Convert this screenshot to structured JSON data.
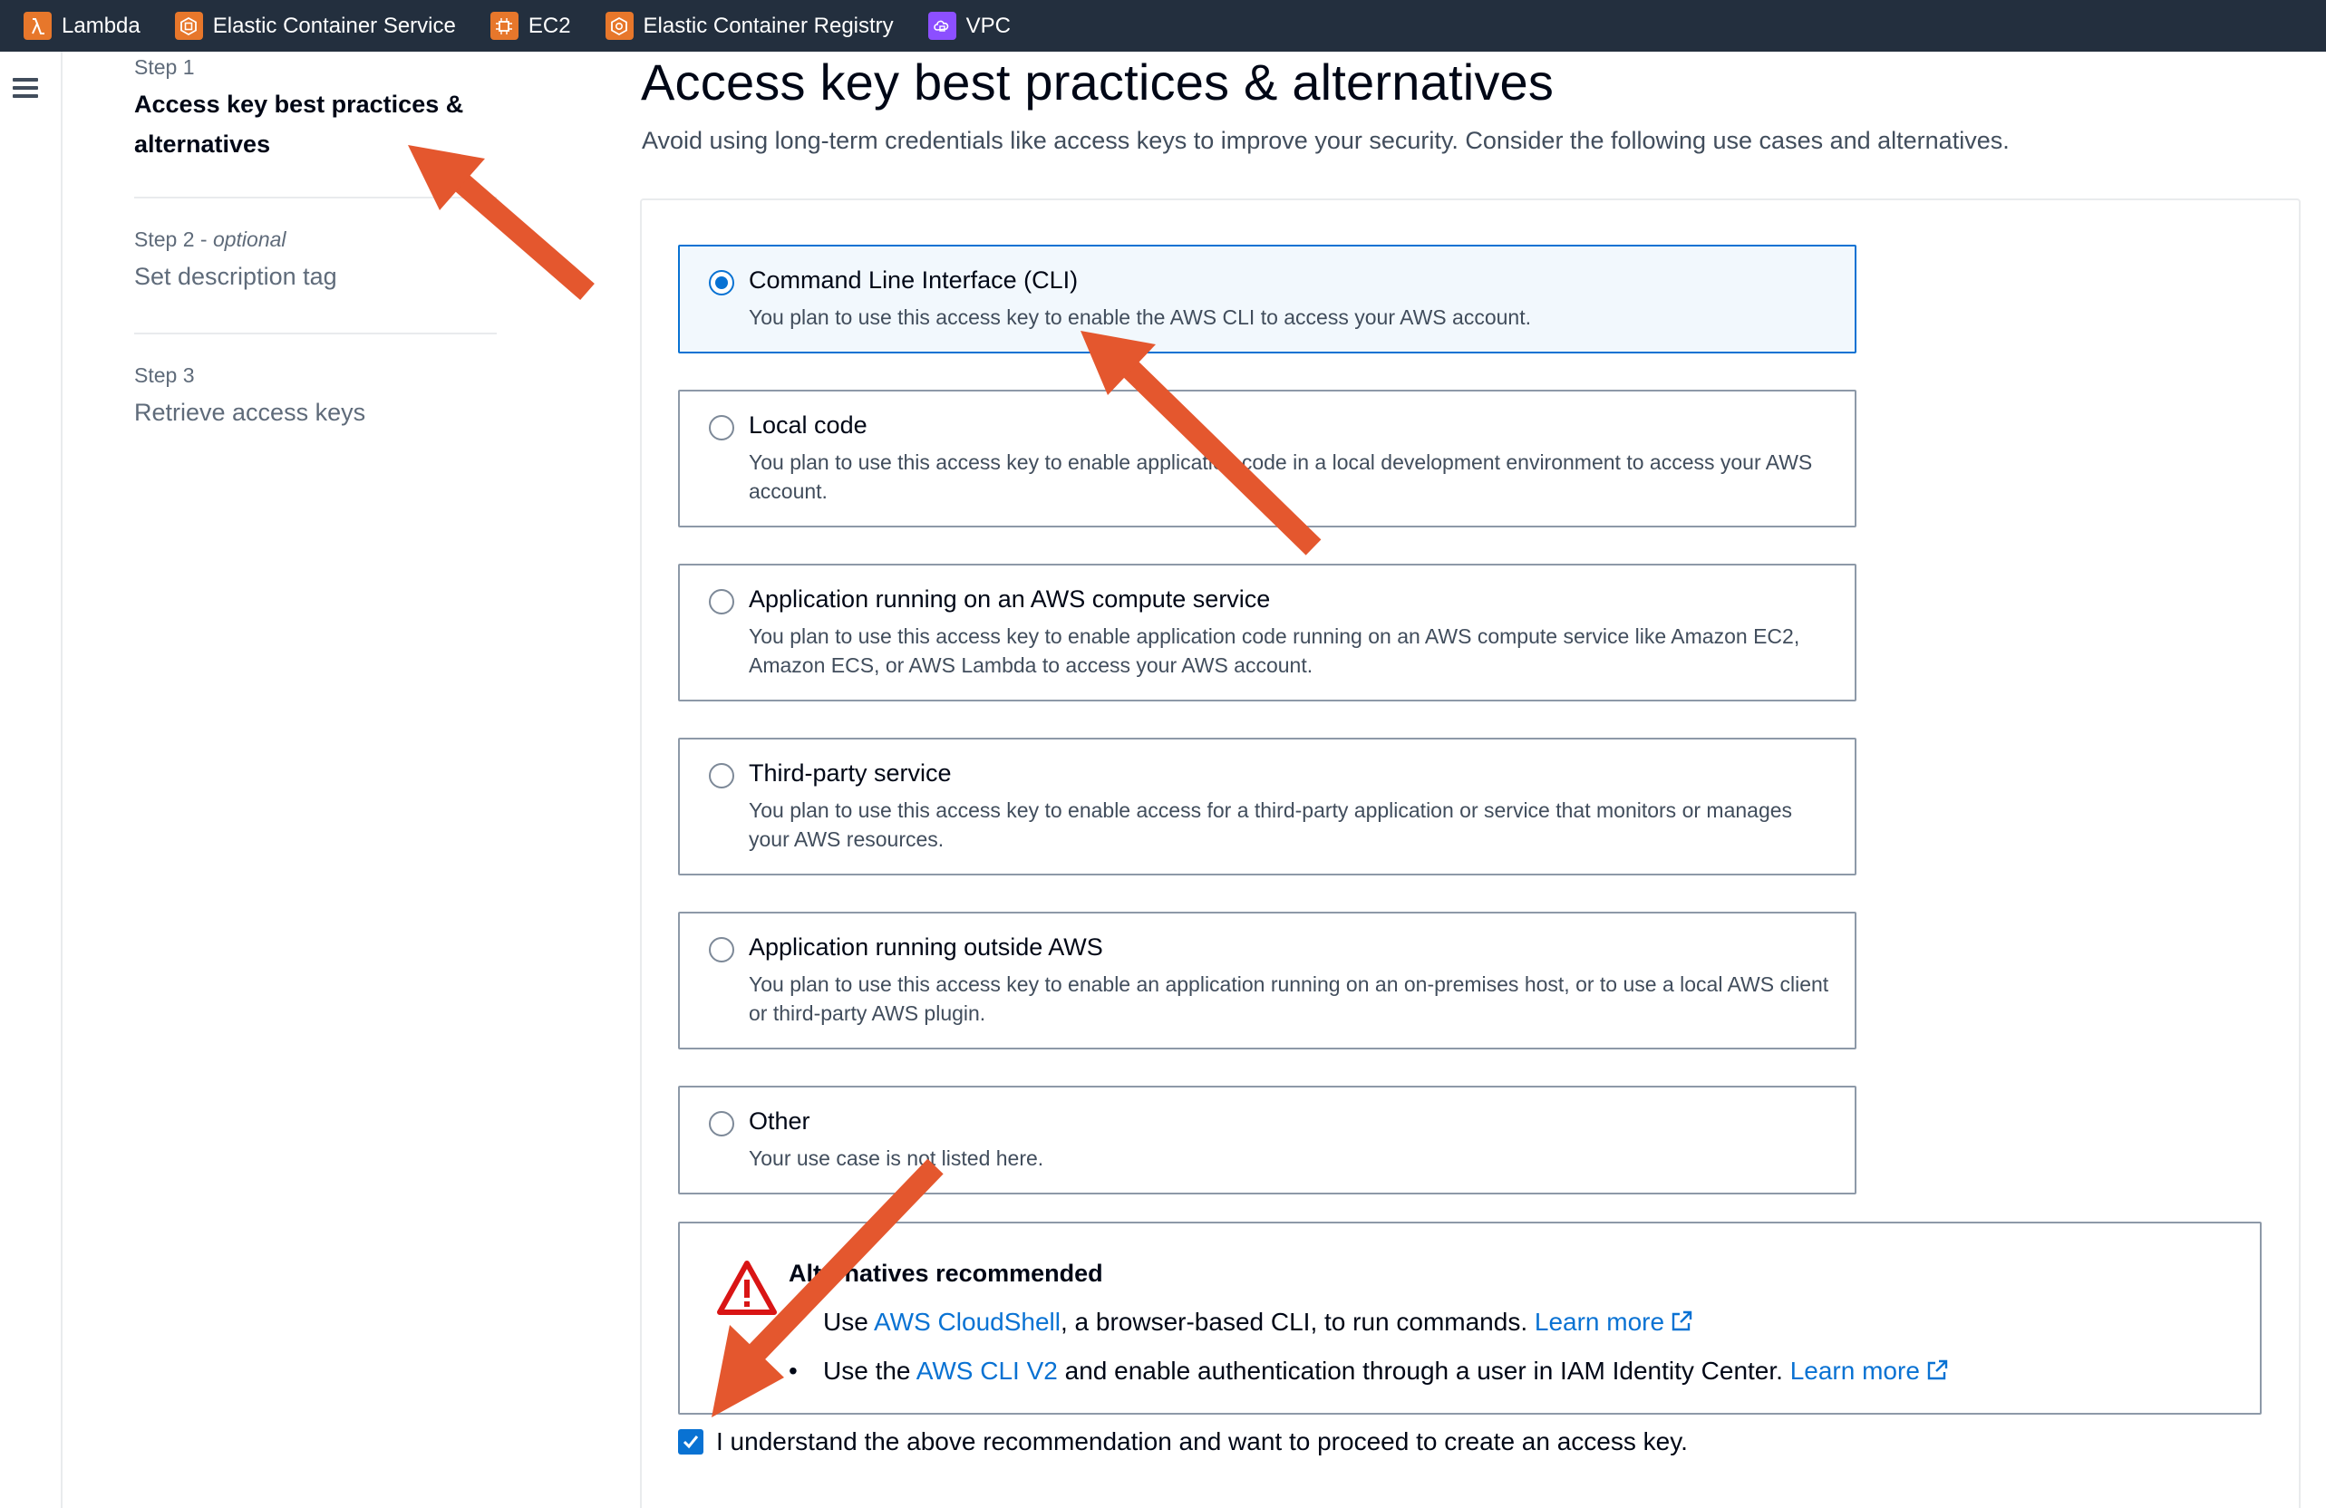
{
  "favorites": [
    {
      "label": "Lambda",
      "icon": "lambda-icon",
      "color": "#e7772b"
    },
    {
      "label": "Elastic Container Service",
      "icon": "container-service-icon",
      "color": "#e7772b"
    },
    {
      "label": "EC2",
      "icon": "ec2-icon",
      "color": "#e7772b"
    },
    {
      "label": "Elastic Container Registry",
      "icon": "container-registry-icon",
      "color": "#e7772b"
    },
    {
      "label": "VPC",
      "icon": "vpc-icon",
      "color": "#8c4fff"
    }
  ],
  "steps": [
    {
      "number": "Step 1",
      "optional": "",
      "title": "Access key best practices &",
      "title2": "alternatives"
    },
    {
      "number": "Step 2",
      "optional": "optional",
      "title": "Set description tag"
    },
    {
      "number": "Step 3",
      "optional": "",
      "title": "Retrieve access keys"
    }
  ],
  "page": {
    "title": "Access key best practices & alternatives",
    "description": "Avoid using long-term credentials like access keys to improve your security. Consider the following use cases and alternatives."
  },
  "use_cases": [
    {
      "label": "Command Line Interface (CLI)",
      "description": "You plan to use this access key to enable the AWS CLI to access your AWS account.",
      "selected": true
    },
    {
      "label": "Local code",
      "description": "You plan to use this access key to enable application code in a local development environment to access your AWS account.",
      "selected": false
    },
    {
      "label": "Application running on an AWS compute service",
      "description": "You plan to use this access key to enable application code running on an AWS compute service like Amazon EC2, Amazon ECS, or AWS Lambda to access your AWS account.",
      "selected": false
    },
    {
      "label": "Third-party service",
      "description": "You plan to use this access key to enable access for a third-party application or service that monitors or manages your AWS resources.",
      "selected": false
    },
    {
      "label": "Application running outside AWS",
      "description": "You plan to use this access key to enable an application running on an on-premises host, or to use a local AWS client or third-party AWS plugin.",
      "selected": false
    },
    {
      "label": "Other",
      "description": "Your use case is not listed here.",
      "selected": false
    }
  ],
  "alert": {
    "title": "Alternatives recommended",
    "items": [
      {
        "pre": "Use ",
        "link": "AWS CloudShell",
        "post": ", a browser-based CLI, to run commands. ",
        "learn_more": "Learn more"
      },
      {
        "pre": "Use the ",
        "link": "AWS CLI V2",
        "post": " and enable authentication through a user in IAM Identity Center. ",
        "learn_more": "Learn more"
      }
    ]
  },
  "acknowledge": {
    "label": "I understand the above recommendation and want to proceed to create an access key.",
    "checked": true
  },
  "colors": {
    "topbar": "#232f3e",
    "accent": "#0972d3",
    "warning": "#d91515",
    "annotation_arrow": "#e4572e"
  }
}
